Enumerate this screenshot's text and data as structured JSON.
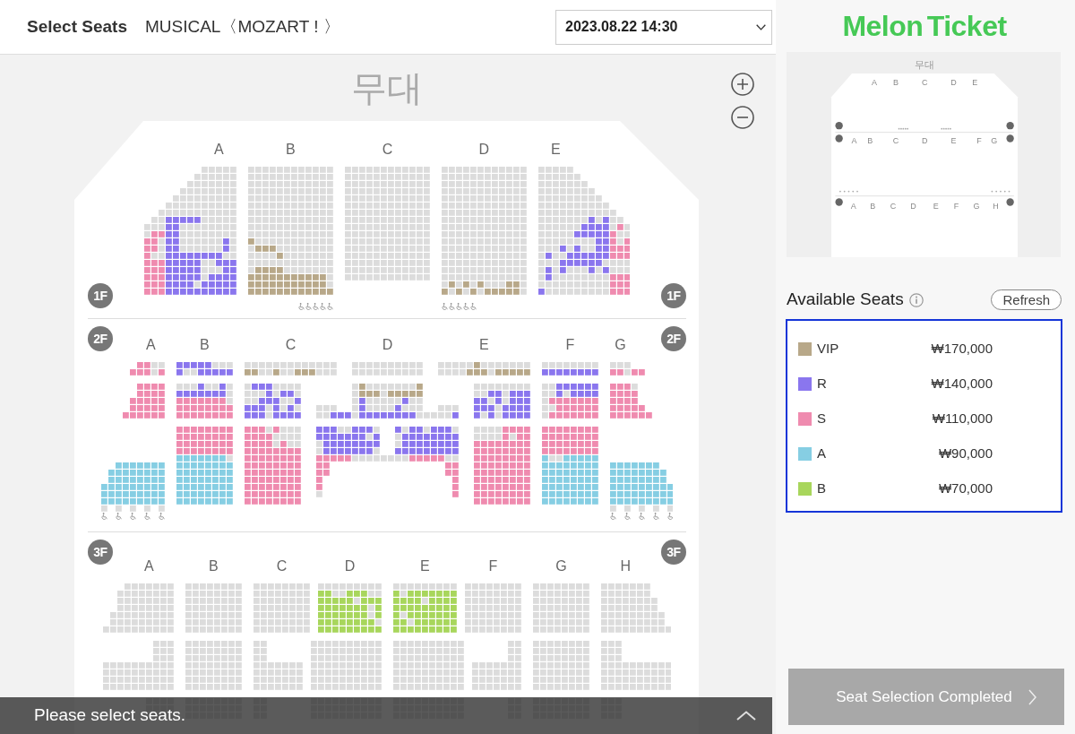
{
  "header": {
    "title": "Select Seats",
    "performance": "MUSICAL〈MOZART ! 〉",
    "date_time": "2023.08.22 14:30"
  },
  "seat_map": {
    "stage_label": "무대",
    "floors": [
      {
        "badges": [
          "1F",
          "1F"
        ],
        "section_labels": [
          "A",
          "B",
          "C",
          "D",
          "E"
        ]
      },
      {
        "badges": [
          "2F",
          "2F"
        ],
        "section_labels": [
          "A",
          "B",
          "C",
          "D",
          "E",
          "F",
          "G"
        ]
      },
      {
        "badges": [
          "3F",
          "3F"
        ],
        "section_labels": [
          "A",
          "B",
          "C",
          "D",
          "E",
          "F",
          "G",
          "H"
        ]
      }
    ]
  },
  "status_bar": {
    "message": "Please select seats."
  },
  "logo": "Melon Ticket",
  "mini_map": {
    "stage_label": "무대",
    "floors": [
      {
        "section_labels": [
          "A",
          "B",
          "C",
          "D",
          "E"
        ]
      },
      {
        "section_labels": [
          "A",
          "B",
          "C",
          "D",
          "E",
          "F",
          "G"
        ]
      },
      {
        "section_labels": [
          "A",
          "B",
          "C",
          "D",
          "E",
          "F",
          "G",
          "H"
        ]
      }
    ]
  },
  "available_seats": {
    "title": "Available Seats",
    "refresh_label": "Refresh",
    "grades": [
      {
        "name": "VIP",
        "price": "₩170,000",
        "color": "#b8a889"
      },
      {
        "name": "R",
        "price": "₩140,000",
        "color": "#8a76ee"
      },
      {
        "name": "S",
        "price": "₩110,000",
        "color": "#ef8baf"
      },
      {
        "name": "A",
        "price": "₩90,000",
        "color": "#86cee3"
      },
      {
        "name": "B",
        "price": "₩70,000",
        "color": "#a8d65c"
      }
    ]
  },
  "complete_button": {
    "label": "Seat Selection Completed"
  }
}
